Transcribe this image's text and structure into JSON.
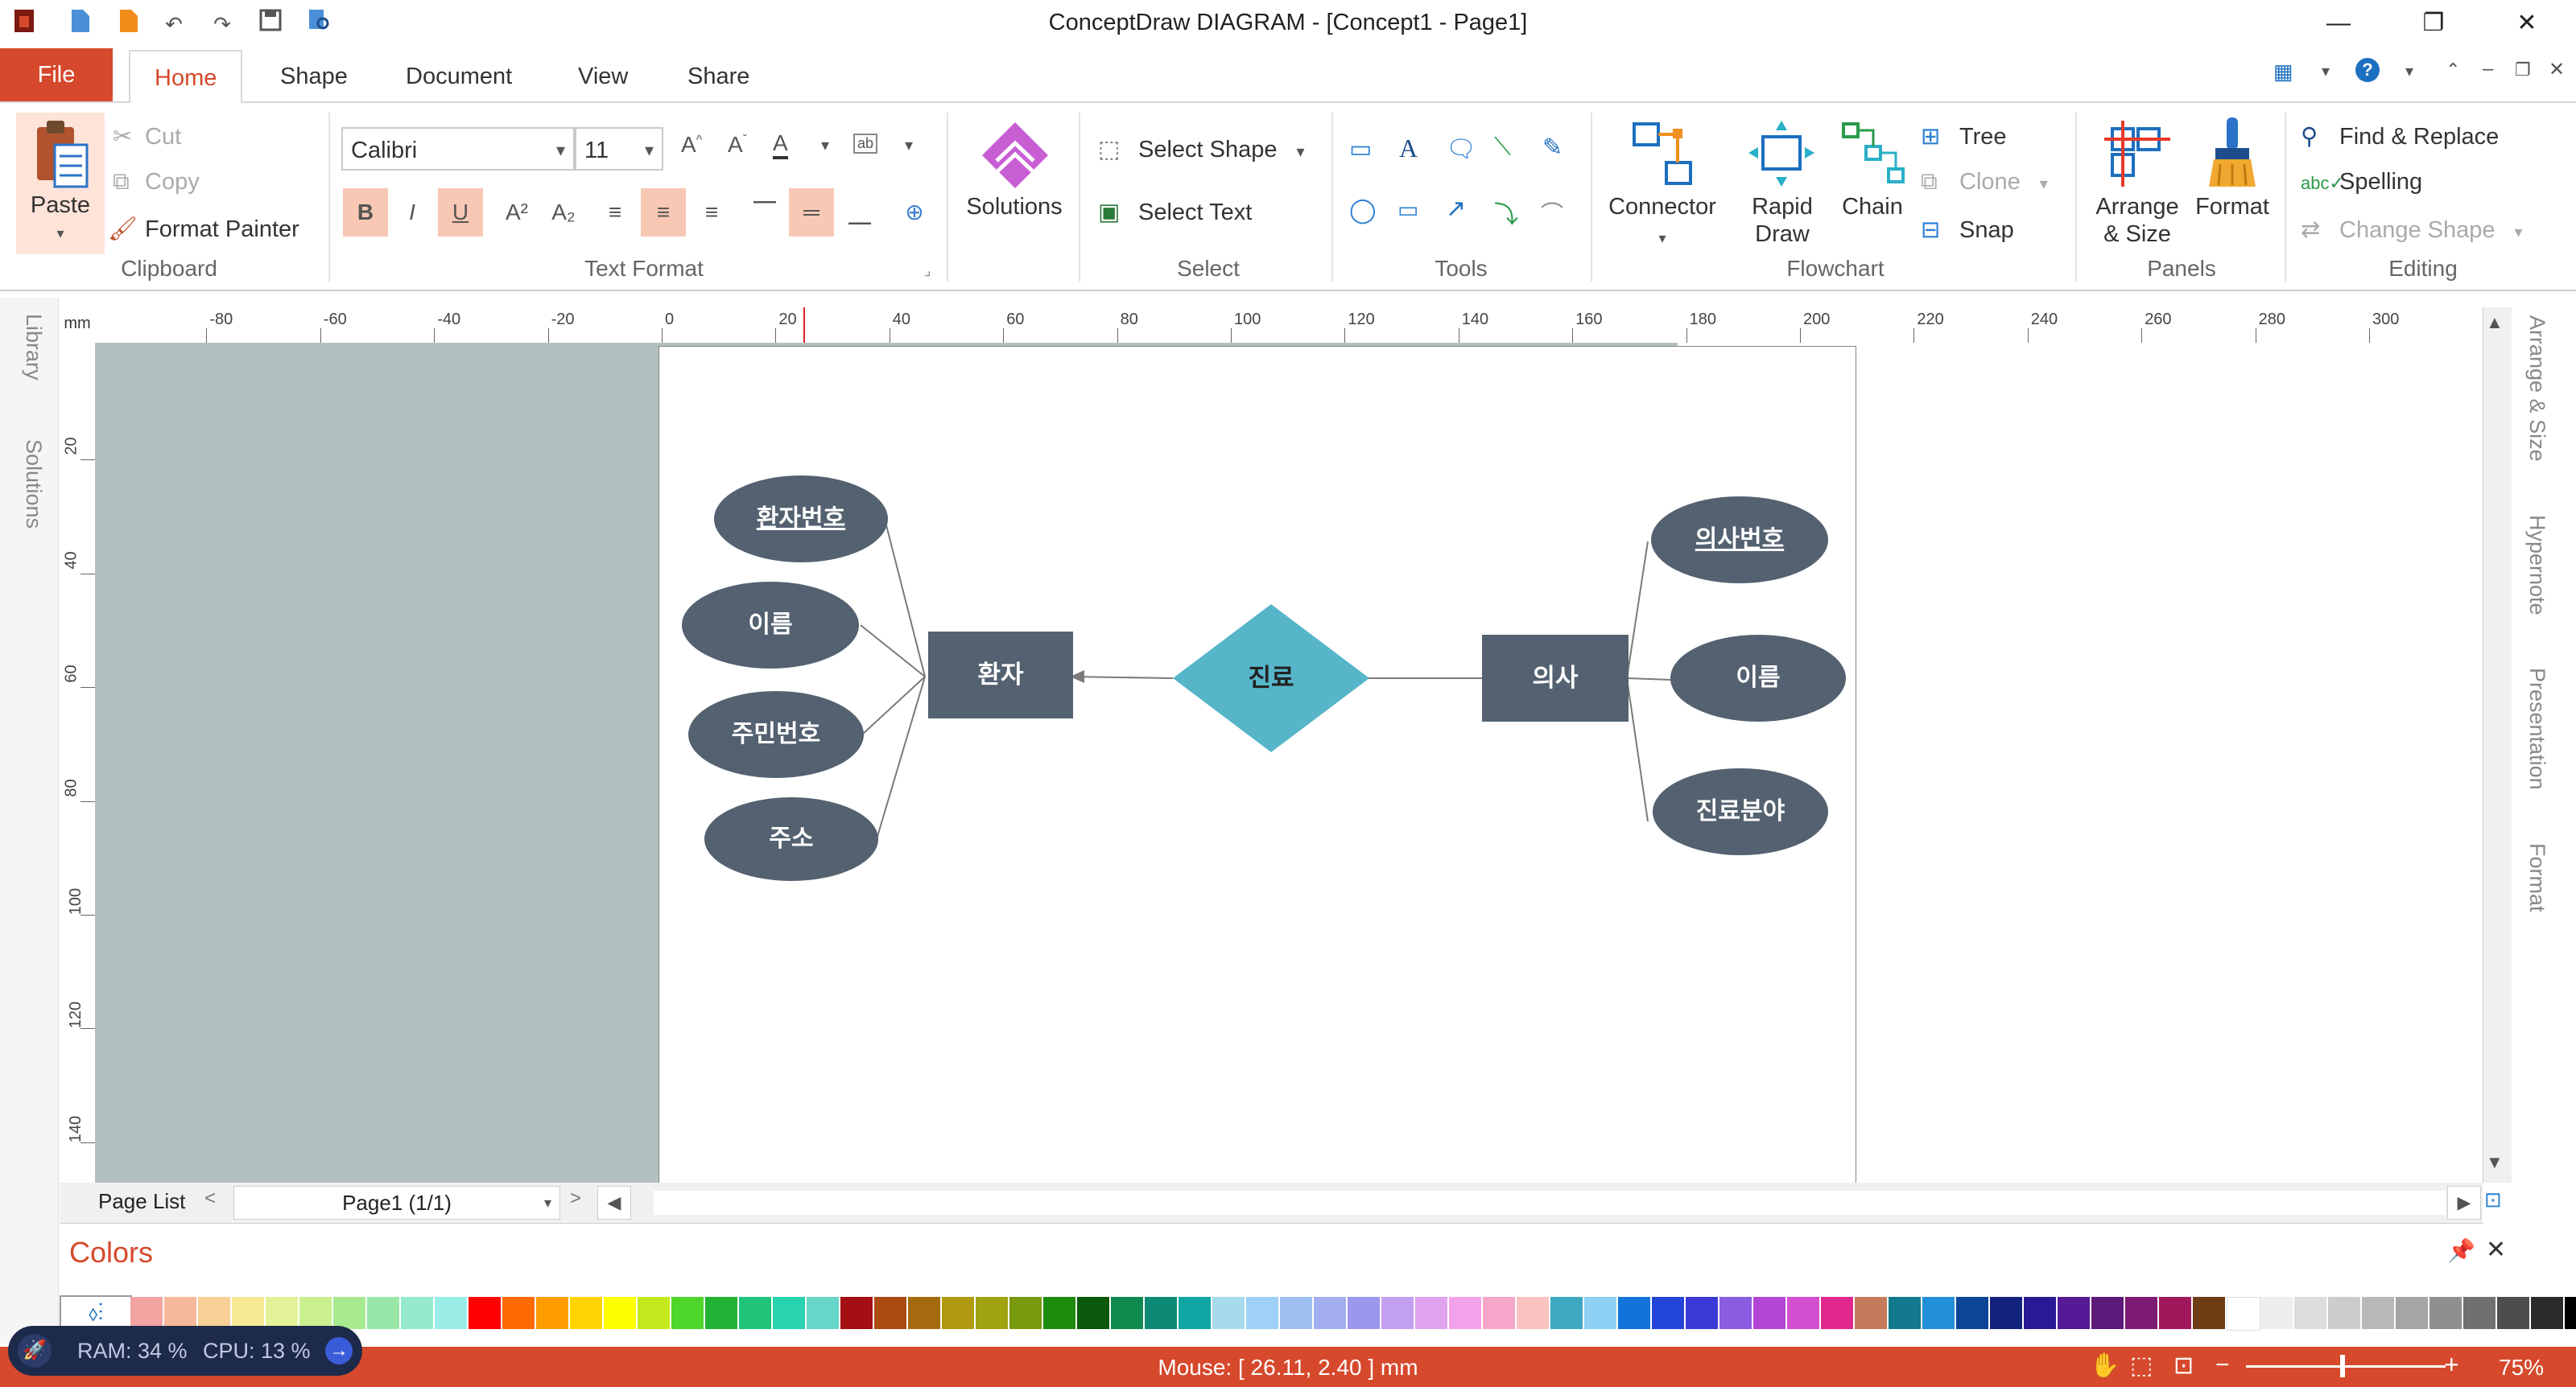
{
  "app": {
    "title": "ConceptDraw DIAGRAM - [Concept1 - Page1]"
  },
  "tabs": {
    "file": "File",
    "home": "Home",
    "shape": "Shape",
    "document": "Document",
    "view": "View",
    "share": "Share"
  },
  "clipboard": {
    "paste": "Paste",
    "cut": "Cut",
    "copy": "Copy",
    "format_painter": "Format Painter",
    "group": "Clipboard"
  },
  "text_format": {
    "font": "Calibri",
    "size": "11",
    "bold": "B",
    "italic": "I",
    "underline": "U",
    "superscript": "A²",
    "subscript": "A₂",
    "group": "Text Format"
  },
  "solutions": {
    "label": "Solutions"
  },
  "select": {
    "select_shape": "Select Shape",
    "select_text": "Select Text",
    "group": "Select"
  },
  "tools": {
    "group": "Tools"
  },
  "flowchart": {
    "connector": "Connector",
    "rapid_draw": "Rapid Draw",
    "chain": "Chain",
    "tree": "Tree",
    "clone": "Clone",
    "snap": "Snap",
    "group": "Flowchart"
  },
  "panels": {
    "arrange_size": "Arrange & Size",
    "format": "Format",
    "group": "Panels"
  },
  "editing": {
    "find_replace": "Find & Replace",
    "spelling": "Spelling",
    "change_shape": "Change Shape",
    "group": "Editing"
  },
  "left_tabs": {
    "library": "Library",
    "solutions": "Solutions"
  },
  "right_tabs": {
    "arrange_size": "Arrange & Size",
    "hypernote": "Hypernote",
    "presentation": "Presentation",
    "format": "Format"
  },
  "ruler": {
    "unit": "mm",
    "top_ticks": [
      "-80",
      "-60",
      "-40",
      "-20",
      "0",
      "20",
      "40",
      "60",
      "80",
      "100",
      "120",
      "140",
      "160",
      "180",
      "200",
      "220",
      "240",
      "260",
      "280",
      "300"
    ],
    "left_ticks": [
      "20",
      "40",
      "60",
      "80",
      "100",
      "120",
      "140"
    ]
  },
  "diagram": {
    "patient_id": "환자번호",
    "patient_name": "이름",
    "patient_rrn": "주민번호",
    "patient_address": "주소",
    "patient": "환자",
    "treatment": "진료",
    "doctor": "의사",
    "doctor_id": "의사번호",
    "doctor_name": "이름",
    "doctor_field": "진료분야"
  },
  "page_list": {
    "label": "Page List",
    "current_page": "Page1 (1/1)"
  },
  "colors_panel": {
    "title": "Colors",
    "swatches": [
      "#f4a3a3",
      "#f6b89a",
      "#f8cf95",
      "#f6ea97",
      "#e3f197",
      "#c9ef8f",
      "#a8ea8f",
      "#98e6a8",
      "#95e9cf",
      "#9beee7",
      "#ff0000",
      "#ff6a00",
      "#ff9d00",
      "#ffd400",
      "#ffff00",
      "#c3e81b",
      "#4fd62a",
      "#21b235",
      "#1fc47a",
      "#28d3b0",
      "#68d6c9",
      "#a30f12",
      "#ab4a12",
      "#a66a0e",
      "#b29a10",
      "#a0a310",
      "#7a9a0d",
      "#1f8b0e",
      "#0b5a0b",
      "#0e8a4e",
      "#0d8a75",
      "#10a6a3",
      "#a7daea",
      "#9fd0f5",
      "#9ec0f3",
      "#a2aef0",
      "#9b97ec",
      "#c4a1f0",
      "#dfa3ee",
      "#f2a2ea",
      "#f6a6c8",
      "#f9c3c2",
      "#3ea8c2",
      "#8dd1f4",
      "#1274d9",
      "#2244d9",
      "#3b3ad6",
      "#8a5ce0",
      "#b347d4",
      "#d34fd0",
      "#e2288f",
      "#c57a5b",
      "#137a8e",
      "#2290d9",
      "#0c4596",
      "#13237d",
      "#2a1996",
      "#561a96",
      "#5e1a7a",
      "#7d1a73",
      "#a1175b",
      "#6d3d14",
      "#ffffff",
      "#eeeeee",
      "#dddddd",
      "#cccccc",
      "#b8b8b8",
      "#a5a5a5",
      "#8f8f8f",
      "#707070",
      "#4d4d4d",
      "#2b2b2b",
      "#000000"
    ]
  },
  "status": {
    "ram": "RAM: 34 %",
    "cpu": "CPU: 13 %",
    "mouse": "Mouse: [ 26.11, 2.40 ] mm",
    "zoom": "75%",
    "zoom_level": 0.47
  }
}
